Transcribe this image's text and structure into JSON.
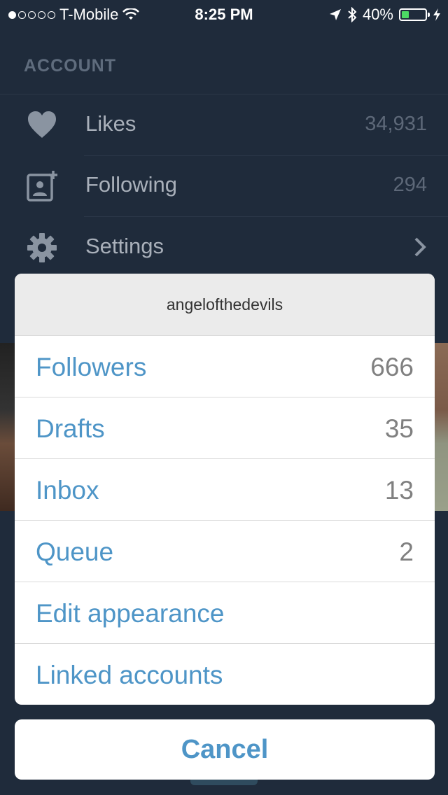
{
  "statusbar": {
    "carrier": "T-Mobile",
    "time": "8:25 PM",
    "battery": "40%",
    "battery_level": 0.4
  },
  "account": {
    "header": "ACCOUNT",
    "rows": [
      {
        "label": "Likes",
        "value": "34,931",
        "icon": "heart-icon"
      },
      {
        "label": "Following",
        "value": "294",
        "icon": "add-contact-icon"
      },
      {
        "label": "Settings",
        "value": "",
        "icon": "gear-icon"
      }
    ]
  },
  "sheet": {
    "title": "angelofthedevils",
    "items": [
      {
        "label": "Followers",
        "value": "666"
      },
      {
        "label": "Drafts",
        "value": "35"
      },
      {
        "label": "Inbox",
        "value": "13"
      },
      {
        "label": "Queue",
        "value": "2"
      },
      {
        "label": "Edit appearance",
        "value": ""
      },
      {
        "label": "Linked accounts",
        "value": ""
      }
    ],
    "cancel": "Cancel"
  },
  "colors": {
    "background": "#1f2b3b",
    "accent": "#4e95c7",
    "battery": "#4cd964"
  }
}
